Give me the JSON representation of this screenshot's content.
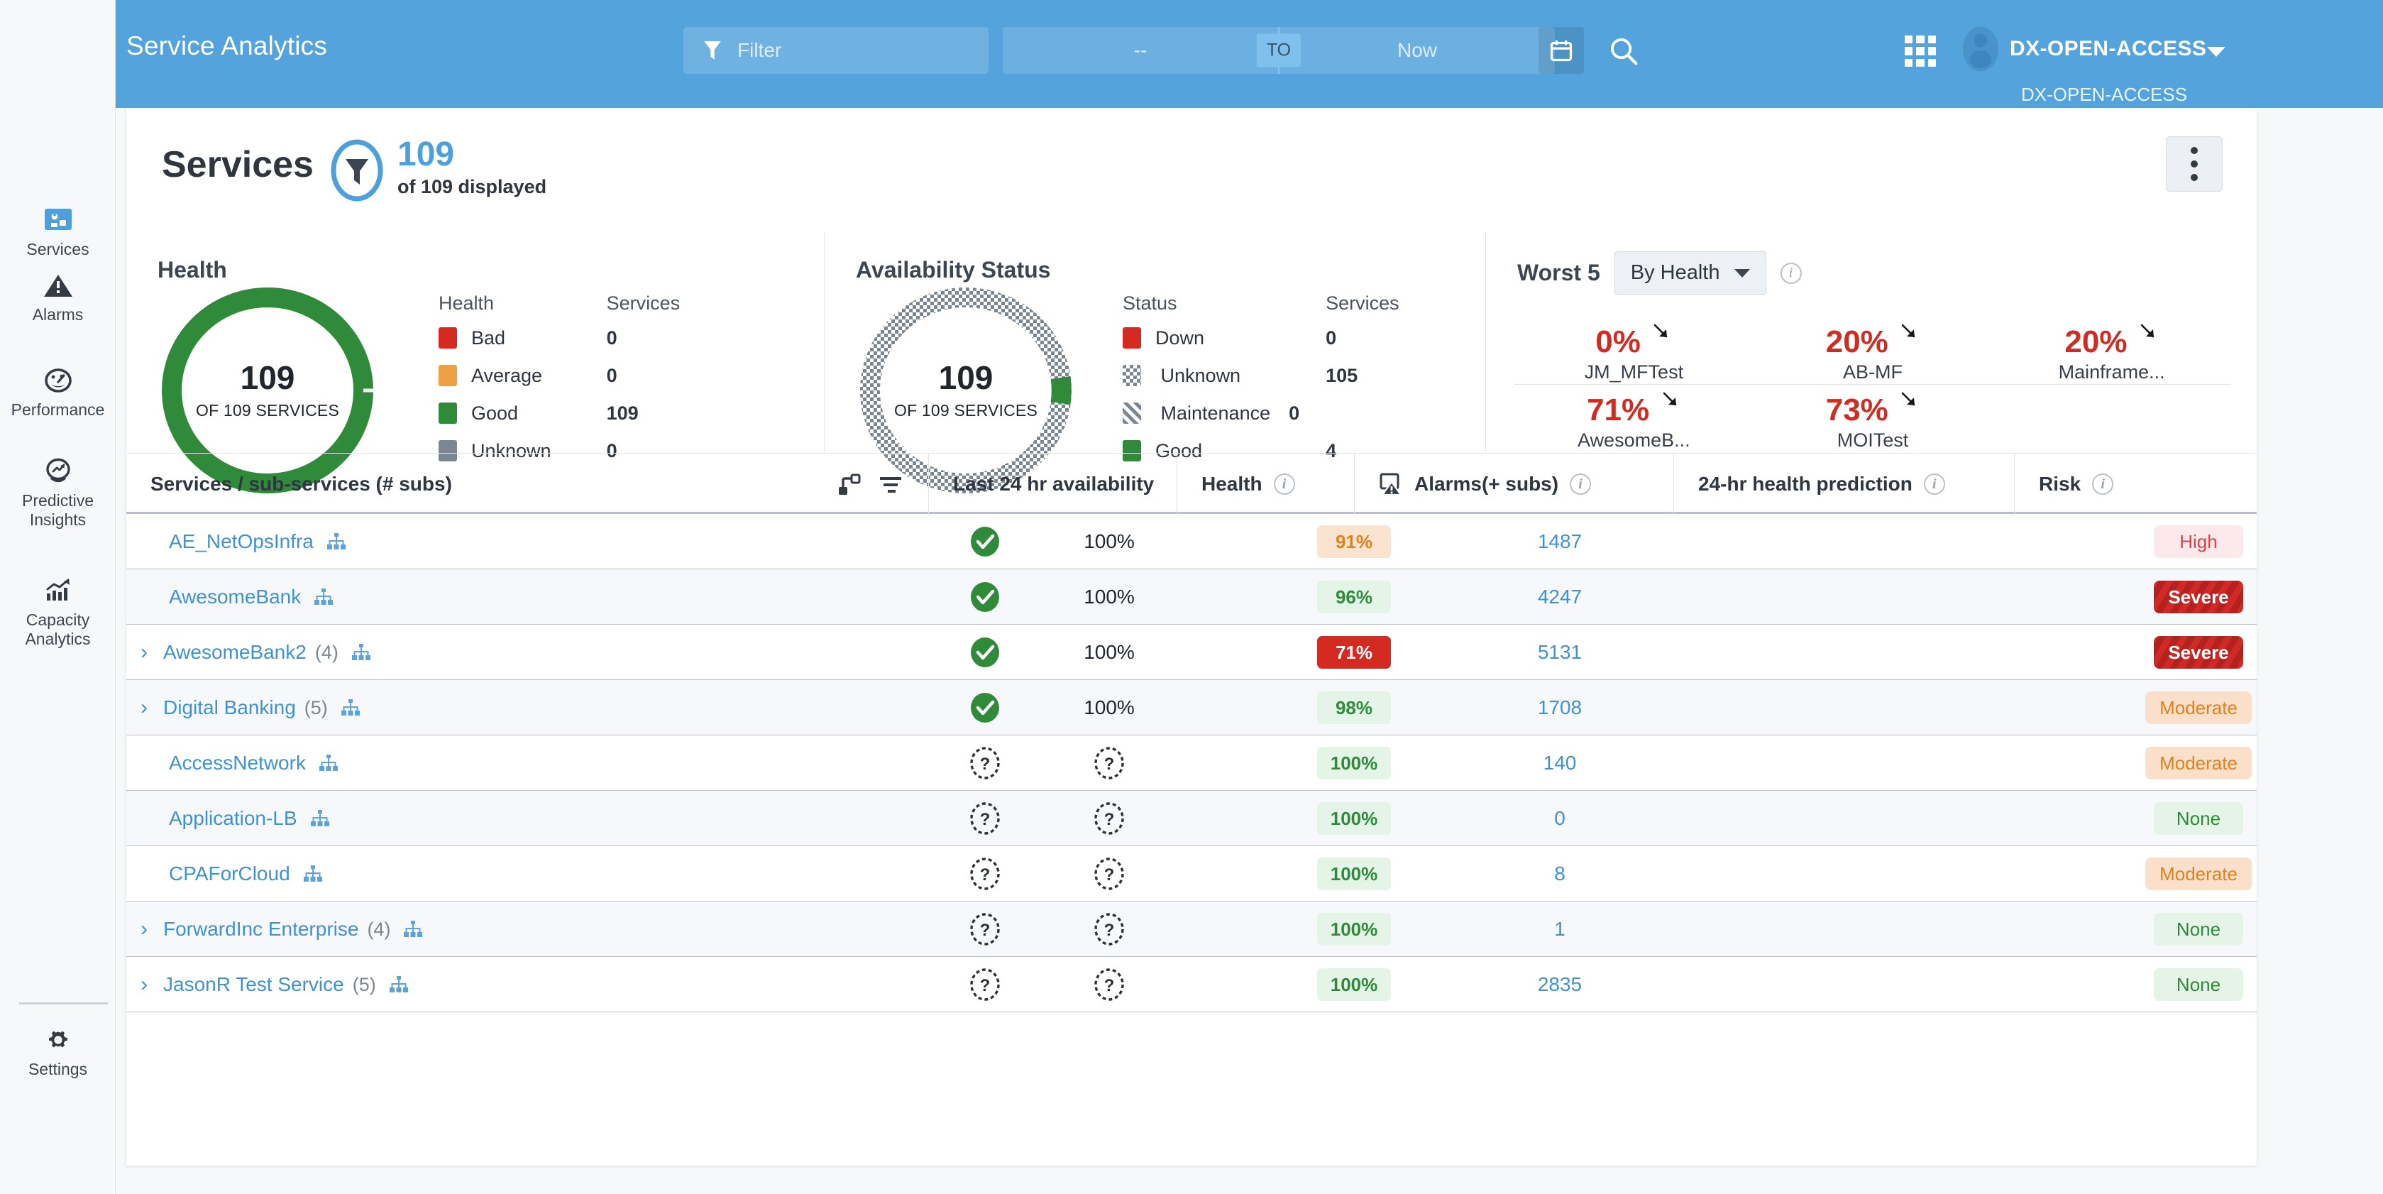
{
  "header": {
    "brand": "Service Analytics",
    "filter_placeholder": "Filter",
    "range_from": "--",
    "range_to_chip": "TO",
    "range_to": "Now",
    "user_name": "DX-OPEN-ACCESS",
    "tenant": "DX-OPEN-ACCESS",
    "icons": [
      "funnel-icon",
      "calendar-icon",
      "search-icon",
      "app-grid-icon",
      "avatar-icon",
      "chevron-down-icon"
    ]
  },
  "sidebar": {
    "items": [
      {
        "label": "Services",
        "icon": "services-icon",
        "active": true
      },
      {
        "label": "Alarms",
        "icon": "alarms-warning-icon",
        "active": false
      },
      {
        "label": "Performance",
        "icon": "performance-gauge-icon",
        "active": false
      },
      {
        "label": "Predictive Insights",
        "icon": "predictive-insights-icon",
        "active": false
      },
      {
        "label": "Capacity Analytics",
        "icon": "capacity-analytics-icon",
        "active": false
      }
    ],
    "settings": {
      "label": "Settings",
      "icon": "gear-icon"
    }
  },
  "page": {
    "title": "Services",
    "badge_count": "109",
    "badge_sub": "of 109 displayed",
    "kebab": "more-options"
  },
  "health_panel": {
    "title": "Health",
    "center_value": "109",
    "center_sub": "OF 109 SERVICES",
    "col_status": "Health",
    "col_services": "Services",
    "legend": [
      {
        "label": "Bad",
        "value": "0",
        "color": "#d42a21"
      },
      {
        "label": "Average",
        "value": "0",
        "color": "#eda044"
      },
      {
        "label": "Good",
        "value": "109",
        "color": "#2f8a39"
      },
      {
        "label": "Unknown",
        "value": "0",
        "color": "#7a8793"
      }
    ]
  },
  "availability_panel": {
    "title": "Availability Status",
    "center_value": "109",
    "center_sub": "OF 109 SERVICES",
    "col_status": "Status",
    "col_services": "Services",
    "legend": [
      {
        "label": "Down",
        "value": "0",
        "color": "#d42a21",
        "pattern": "solid"
      },
      {
        "label": "Unknown",
        "value": "105",
        "color": "#7a8793",
        "pattern": "checker"
      },
      {
        "label": "Maintenance",
        "value": "0",
        "color": "#7a8793",
        "pattern": "stripes"
      },
      {
        "label": "Good",
        "value": "4",
        "color": "#2f8a39",
        "pattern": "solid"
      }
    ]
  },
  "worst_panel": {
    "label": "Worst 5",
    "select_value": "By Health",
    "info": "info-icon",
    "items": [
      {
        "value": "0%",
        "name": "JM_MFTest",
        "trend": "down"
      },
      {
        "value": "20%",
        "name": "AB-MF",
        "trend": "down"
      },
      {
        "value": "20%",
        "name": "Mainframe...",
        "trend": "down"
      },
      {
        "value": "71%",
        "name": "AwesomeB...",
        "trend": "down"
      },
      {
        "value": "73%",
        "name": "MOITest",
        "trend": "down"
      }
    ]
  },
  "table": {
    "columns": [
      {
        "label": "Services / sub-services (# subs)",
        "info": false
      },
      {
        "label": "",
        "info": false
      },
      {
        "label": "Last 24 hr availability",
        "info": false
      },
      {
        "label": "Health",
        "info": true
      },
      {
        "label": "Alarms(+ subs)",
        "info": true,
        "icon": "alarm-icon"
      },
      {
        "label": "24-hr health prediction",
        "info": true
      },
      {
        "label": "Risk",
        "info": true
      }
    ],
    "rows": [
      {
        "expandable": false,
        "name": "AE_NetOpsInfra",
        "subs": "",
        "status": "good",
        "availability": "100%",
        "availability_kind": "text",
        "health": "91%",
        "health_style": "orange",
        "alarms": "1487",
        "prediction": "",
        "risk": "High",
        "risk_style": "high"
      },
      {
        "expandable": false,
        "name": "AwesomeBank",
        "subs": "",
        "status": "good",
        "availability": "100%",
        "availability_kind": "text",
        "health": "96%",
        "health_style": "green",
        "alarms": "4247",
        "prediction": "",
        "risk": "Severe",
        "risk_style": "severe"
      },
      {
        "expandable": true,
        "name": "AwesomeBank2",
        "subs": "(4)",
        "status": "good",
        "availability": "100%",
        "availability_kind": "text",
        "health": "71%",
        "health_style": "red",
        "alarms": "5131",
        "prediction": "",
        "risk": "Severe",
        "risk_style": "severe"
      },
      {
        "expandable": true,
        "name": "Digital Banking",
        "subs": "(5)",
        "status": "good",
        "availability": "100%",
        "availability_kind": "text",
        "health": "98%",
        "health_style": "green",
        "alarms": "1708",
        "prediction": "",
        "risk": "Moderate",
        "risk_style": "moderate"
      },
      {
        "expandable": false,
        "name": "AccessNetwork",
        "subs": "",
        "status": "unknown",
        "availability": "",
        "availability_kind": "unknown",
        "health": "100%",
        "health_style": "green",
        "alarms": "140",
        "prediction": "",
        "risk": "Moderate",
        "risk_style": "moderate"
      },
      {
        "expandable": false,
        "name": "Application-LB",
        "subs": "",
        "status": "unknown",
        "availability": "",
        "availability_kind": "unknown",
        "health": "100%",
        "health_style": "green",
        "alarms": "0",
        "prediction": "",
        "risk": "None",
        "risk_style": "none"
      },
      {
        "expandable": false,
        "name": "CPAForCloud",
        "subs": "",
        "status": "unknown",
        "availability": "",
        "availability_kind": "unknown",
        "health": "100%",
        "health_style": "green",
        "alarms": "8",
        "prediction": "",
        "risk": "Moderate",
        "risk_style": "moderate"
      },
      {
        "expandable": true,
        "name": "ForwardInc Enterprise",
        "subs": "(4)",
        "status": "unknown",
        "availability": "",
        "availability_kind": "unknown",
        "health": "100%",
        "health_style": "green",
        "alarms": "1",
        "prediction": "",
        "risk": "None",
        "risk_style": "none"
      },
      {
        "expandable": true,
        "name": "JasonR Test Service",
        "subs": "(5)",
        "status": "unknown",
        "availability": "",
        "availability_kind": "unknown",
        "health": "100%",
        "health_style": "green",
        "alarms": "2835",
        "prediction": "",
        "risk": "None",
        "risk_style": "none"
      }
    ]
  },
  "chart_data": [
    {
      "type": "pie",
      "title": "Health",
      "categories": [
        "Bad",
        "Average",
        "Good",
        "Unknown"
      ],
      "values": [
        0,
        0,
        109,
        0
      ],
      "colors": [
        "#d42a21",
        "#eda044",
        "#2f8a39",
        "#7a8793"
      ],
      "total": 109,
      "center_label": "109",
      "center_sublabel": "OF 109 SERVICES",
      "legend": "right"
    },
    {
      "type": "pie",
      "title": "Availability Status",
      "categories": [
        "Down",
        "Unknown",
        "Maintenance",
        "Good"
      ],
      "values": [
        0,
        105,
        0,
        4
      ],
      "colors": [
        "#d42a21",
        "#7a8793",
        "#7a8793",
        "#2f8a39"
      ],
      "total": 109,
      "center_label": "109",
      "center_sublabel": "OF 109 SERVICES",
      "legend": "right"
    }
  ]
}
